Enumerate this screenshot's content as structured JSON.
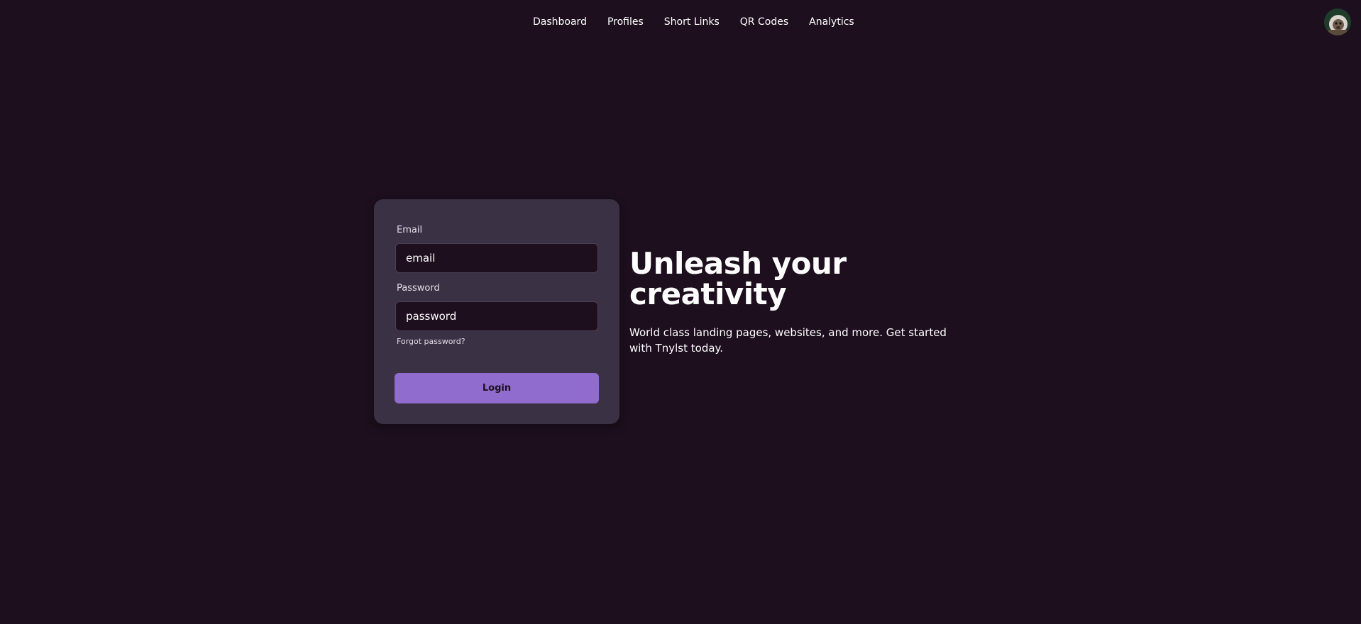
{
  "nav": {
    "items": [
      {
        "label": "Dashboard"
      },
      {
        "label": "Profiles"
      },
      {
        "label": "Short Links"
      },
      {
        "label": "QR Codes"
      },
      {
        "label": "Analytics"
      }
    ],
    "avatar_icon": "user-avatar"
  },
  "login": {
    "email_label": "Email",
    "email_placeholder": "email",
    "email_value": "",
    "password_label": "Password",
    "password_placeholder": "password",
    "password_value": "",
    "forgot_label": "Forgot password?",
    "submit_label": "Login"
  },
  "hero": {
    "title": "Unleash your creativity",
    "subtitle": "World class landing pages, websites, and more. Get started with Tnylst today."
  },
  "colors": {
    "background": "#1d0f1e",
    "card": "#3b3145",
    "input": "#1e0f1e",
    "accent": "#8f6ccd",
    "text": "#ffffff"
  }
}
